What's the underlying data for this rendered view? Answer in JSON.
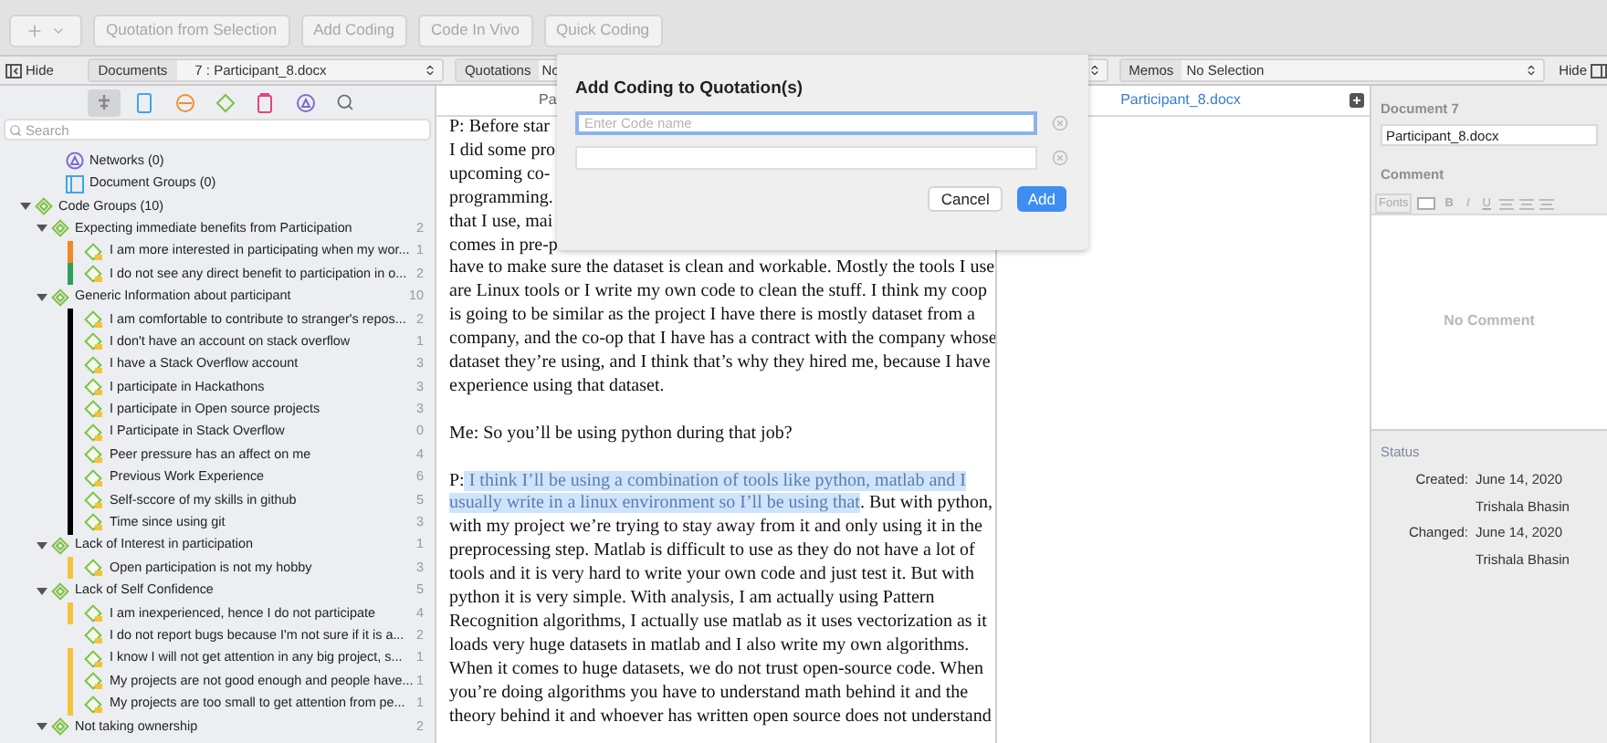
{
  "toolbar": {
    "add_button": {
      "disabled": true
    },
    "buttons": [
      {
        "label": "Quotation from Selection",
        "disabled": true
      },
      {
        "label": "Add Coding",
        "disabled": true
      },
      {
        "label": "Code In Vivo",
        "disabled": true
      },
      {
        "label": "Quick Coding",
        "disabled": true
      }
    ]
  },
  "selector_bar": {
    "hide_left": "Hide",
    "documents_label": "Documents",
    "documents_value": "7 : Participant_8.docx",
    "quotations_label": "Quotations",
    "quotations_value": "No",
    "memos_label": "Memos",
    "memos_value": "No Selection",
    "hide_right": "Hide"
  },
  "sidebar": {
    "tabs": [
      {
        "kind": "code",
        "selected": true
      },
      {
        "kind": "document",
        "selected": false
      },
      {
        "kind": "quotation",
        "selected": false
      },
      {
        "kind": "group",
        "selected": false
      },
      {
        "kind": "memo",
        "selected": false
      },
      {
        "kind": "network",
        "selected": false
      },
      {
        "kind": "search",
        "selected": false
      }
    ],
    "search": {
      "placeholder": "Search"
    },
    "tree": [
      {
        "kind": "network",
        "label": "Networks (0)"
      },
      {
        "kind": "document_group",
        "label": "Document Groups (0)"
      },
      {
        "kind": "code_group",
        "label": "Code Groups (10)",
        "expanded": true,
        "children": [
          {
            "kind": "group",
            "label": "Expecting immediate benefits from Participation",
            "count": "2",
            "expanded": true,
            "children": [
              {
                "kind": "code",
                "label": "I am more interested in participating when my wor...",
                "count": "1",
                "color": "#f08a24"
              },
              {
                "kind": "code",
                "label": "I do not see any direct benefit to participation in o...",
                "count": "2",
                "color": "#2e9e5b"
              }
            ]
          },
          {
            "kind": "group",
            "label": "Generic Information about participant",
            "count": "10",
            "expanded": true,
            "children": [
              {
                "kind": "code",
                "label": "I am comfortable to contribute to stranger's repos...",
                "count": "2",
                "color": "#000000"
              },
              {
                "kind": "code",
                "label": "I don't have an account on stack overflow",
                "count": "1",
                "color": "#000000"
              },
              {
                "kind": "code",
                "label": "I have a Stack Overflow account",
                "count": "3",
                "color": "#000000"
              },
              {
                "kind": "code",
                "label": "I participate in Hackathons",
                "count": "3",
                "color": "#000000"
              },
              {
                "kind": "code",
                "label": "I participate in Open source projects",
                "count": "3",
                "color": "#000000"
              },
              {
                "kind": "code",
                "label": "I Participate in Stack Overflow",
                "count": "0",
                "color": "#000000"
              },
              {
                "kind": "code",
                "label": "Peer pressure has an affect on me",
                "count": "4",
                "color": "#000000"
              },
              {
                "kind": "code",
                "label": "Previous Work Experience",
                "count": "6",
                "color": "#000000"
              },
              {
                "kind": "code",
                "label": "Self-sccore of my skills in github",
                "count": "5",
                "color": "#000000"
              },
              {
                "kind": "code",
                "label": "Time since using git",
                "count": "3",
                "color": "#000000"
              }
            ]
          },
          {
            "kind": "group",
            "label": "Lack of Interest in participation",
            "count": "1",
            "expanded": true,
            "children": [
              {
                "kind": "code",
                "label": "Open participation is not my hobby",
                "count": "3",
                "color": "#f5c33b"
              }
            ]
          },
          {
            "kind": "group",
            "label": "Lack of Self Confidence",
            "count": "5",
            "expanded": true,
            "children": [
              {
                "kind": "code",
                "label": "I am inexperienced, hence I do not participate",
                "count": "4",
                "color": "#f5c33b"
              },
              {
                "kind": "code",
                "label": "I do not report bugs because I'm not sure if it is a...",
                "count": "2"
              },
              {
                "kind": "code",
                "label": "I know I will not get attention in any big project, s...",
                "count": "1",
                "color": "#f5c33b"
              },
              {
                "kind": "code",
                "label": "My projects are not good enough and people have...",
                "count": "1",
                "color": "#f5c33b"
              },
              {
                "kind": "code",
                "label": "My projects are too small to get attention from pe...",
                "count": "1",
                "color": "#f5c33b"
              }
            ]
          },
          {
            "kind": "group",
            "label": "Not taking ownership",
            "count": "2",
            "expanded": true
          }
        ]
      }
    ]
  },
  "document": {
    "header": "Pa",
    "paragraphs": [
      {
        "lines": [
          [
            {
              "text": "P: Before star",
              "highlighted": false
            }
          ],
          [
            {
              "text": "I did some pro",
              "highlighted": false
            }
          ],
          [
            {
              "text": "upcoming co-",
              "highlighted": false
            }
          ],
          [
            {
              "text": "programming.",
              "highlighted": false
            }
          ],
          [
            {
              "text": "that I use, mai",
              "highlighted": false
            }
          ],
          [
            {
              "text": "comes in pre-p",
              "highlighted": false
            }
          ],
          [
            {
              "text": "have to make sure the dataset is clean and workable. Mostly the tools I use",
              "highlighted": false
            }
          ],
          [
            {
              "text": "are Linux tools or I write my own code to clean the stuff. I think my coop",
              "highlighted": false
            }
          ],
          [
            {
              "text": "is going to be similar as the project I have there is mostly dataset from a",
              "highlighted": false
            }
          ],
          [
            {
              "text": "company, and the co-op that I have has a contract with the company whose",
              "highlighted": false
            }
          ],
          [
            {
              "text": "dataset they’re using, and I think that’s why they hired me, because I have",
              "highlighted": false
            }
          ],
          [
            {
              "text": "experience using that dataset.",
              "highlighted": false
            }
          ]
        ]
      },
      {
        "lines": [
          [
            {
              "text": "Me: So you’ll be using python during that job?",
              "highlighted": false
            }
          ]
        ]
      },
      {
        "lines": [
          [
            {
              "text": "P:",
              "highlighted": false
            },
            {
              "text": " I think I’ll be using a combination of tools like python, matlab and I",
              "highlighted": true
            }
          ],
          [
            {
              "text": "usually write in a linux environment so I’ll be using that",
              "highlighted": true
            },
            {
              "text": ". But with python,",
              "highlighted": false
            }
          ],
          [
            {
              "text": "with my project we’re trying to stay away from it and only using it in the",
              "highlighted": false
            }
          ],
          [
            {
              "text": "preprocessing step. Matlab is difficult to use as they do not have a lot of",
              "highlighted": false
            }
          ],
          [
            {
              "text": "tools and it is very hard to write your own code and just test it. But with",
              "highlighted": false
            }
          ],
          [
            {
              "text": "python it is very simple. With analysis, I am actually using Pattern",
              "highlighted": false
            }
          ],
          [
            {
              "text": "Recognition algorithms, I actually use matlab as it uses vectorization as it",
              "highlighted": false
            }
          ],
          [
            {
              "text": "loads very huge datasets in matlab and I also write my own algorithms.",
              "highlighted": false
            }
          ],
          [
            {
              "text": "When it comes to huge datasets, we do not trust open-source code. When",
              "highlighted": false
            }
          ],
          [
            {
              "text": "you’re doing algorithms you have to understand math behind it and the",
              "highlighted": false
            }
          ],
          [
            {
              "text": "theory behind it and whoever has written open source does not understand",
              "highlighted": false
            }
          ]
        ]
      }
    ]
  },
  "margin_pane": {
    "header": "Participant_8.docx"
  },
  "inspector": {
    "title": "Document 7",
    "name_value": "Participant_8.docx",
    "comment_label": "Comment",
    "format_toolbar": {
      "fonts": "Fonts",
      "bold": "B",
      "italic": "I",
      "underline": "U"
    },
    "comment_placeholder": "No Comment",
    "status": {
      "title": "Status",
      "rows": [
        {
          "label": "Created:",
          "date": "June 14, 2020",
          "author": "Trishala Bhasin"
        },
        {
          "label": "Changed:",
          "date": "June 14, 2020",
          "author": "Trishala Bhasin"
        }
      ]
    }
  },
  "dialog": {
    "title": "Add Coding to Quotation(s)",
    "fields": [
      {
        "placeholder": "Enter Code name",
        "focused": true
      },
      {
        "focused": false
      }
    ],
    "buttons": [
      {
        "label": "Cancel",
        "kind": "secondary"
      },
      {
        "label": "Add",
        "kind": "primary"
      }
    ]
  }
}
